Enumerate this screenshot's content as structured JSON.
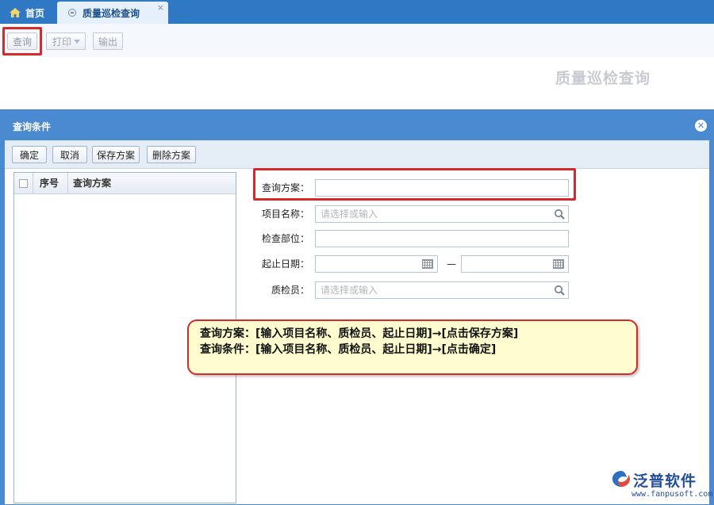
{
  "tabs": {
    "home": "首页",
    "active": "质量巡检查询",
    "close": "×"
  },
  "toolbar": {
    "query": "查询",
    "print": "打印",
    "export": "输出"
  },
  "page_title": "质量巡检查询",
  "dialog": {
    "title": "查询条件",
    "close": "✕",
    "buttons": {
      "ok": "确定",
      "cancel": "取消",
      "save_scheme": "保存方案",
      "delete_scheme": "删除方案"
    },
    "list": {
      "col_no": "序号",
      "col_name": "查询方案"
    },
    "form": {
      "scheme_label": "查询方案：",
      "project_label": "项目名称：",
      "project_placeholder": "请选择或输入",
      "part_label": "检查部位：",
      "date_label": "起止日期：",
      "date_sep": "—",
      "inspector_label": "质检员：",
      "inspector_placeholder": "请选择或输入"
    }
  },
  "callout": {
    "line1": "查询方案：[输入项目名称、质检员、起止日期]→[点击保存方案]",
    "line2": "查询条件：[输入项目名称、质检员、起止日期]→[点击确定]"
  },
  "brand": {
    "name": "泛普软件",
    "url": "www.fanpusoft.com"
  },
  "colors": {
    "tabbar": "#2f78c4",
    "dialog_header": "#4a8ad0",
    "highlight": "#d42a2a",
    "callout_bg": "#fffdcf",
    "brand": "#234f9a"
  }
}
